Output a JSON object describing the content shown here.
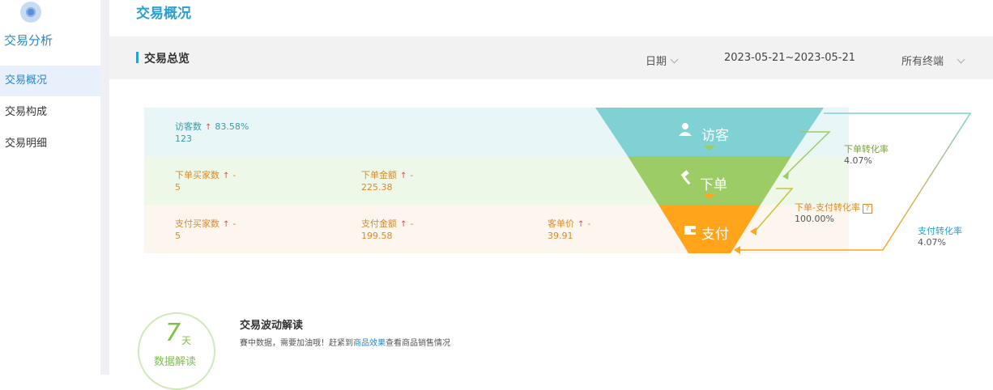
{
  "sidebar": {
    "title": "交易分析",
    "items": [
      {
        "label": "交易概况",
        "active": true
      },
      {
        "label": "交易构成",
        "active": false
      },
      {
        "label": "交易明细",
        "active": false
      }
    ]
  },
  "page": {
    "title": "交易概况"
  },
  "toolbar": {
    "section_title": "交易总览",
    "date_label": "日期",
    "date_range": "2023-05-21~2023-05-21",
    "terminal_label": "所有终端"
  },
  "metrics": {
    "visitors": {
      "label": "访客数",
      "change": "83.58%",
      "value": "123"
    },
    "order_buyers": {
      "label": "下单买家数",
      "change": "-",
      "value": "5"
    },
    "order_amount": {
      "label": "下单金额",
      "change": "-",
      "value": "225.38"
    },
    "pay_buyers": {
      "label": "支付买家数",
      "change": "-",
      "value": "5"
    },
    "pay_amount": {
      "label": "支付金额",
      "change": "-",
      "value": "199.58"
    },
    "unit_price": {
      "label": "客单价",
      "change": "-",
      "value": "39.91"
    }
  },
  "funnel": {
    "visit": "访客",
    "order": "下单",
    "pay": "支付",
    "colors": {
      "visit": "#7fd1d4",
      "order": "#9ccc65",
      "pay": "#ffa41b"
    }
  },
  "conversions": {
    "order_rate": {
      "label": "下单转化率",
      "value": "4.07%"
    },
    "order_pay_rate": {
      "label": "下单-支付转化率",
      "value": "100.00%"
    },
    "pay_rate": {
      "label": "支付转化率",
      "value": "4.07%"
    }
  },
  "wave": {
    "badge_num": "7",
    "badge_unit": "天",
    "badge_sub": "数据解读",
    "title": "交易波动解读",
    "text_prefix": "賽中数据，需要加油哦！赶紧到",
    "link": "商品效果",
    "text_suffix": "查看商品销售情况"
  }
}
